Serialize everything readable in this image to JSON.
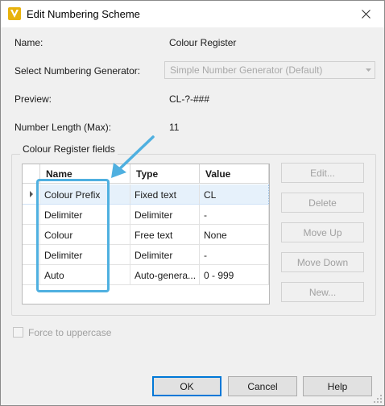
{
  "window": {
    "title": "Edit Numbering Scheme",
    "icon": "v-app-icon",
    "close_icon": "close-icon"
  },
  "form": {
    "name_label": "Name:",
    "name_value": "Colour Register",
    "generator_label": "Select Numbering Generator:",
    "generator_value": "Simple Number Generator (Default)",
    "preview_label": "Preview:",
    "preview_value": "CL-?-###",
    "length_label": "Number Length (Max):",
    "length_value": "11"
  },
  "fields_group": {
    "legend": "Colour Register fields",
    "columns": [
      "Name",
      "Type",
      "Value"
    ],
    "rows": [
      {
        "name": "Colour Prefix",
        "type": "Fixed text",
        "value": "CL",
        "selected": true
      },
      {
        "name": "Delimiter",
        "type": "Delimiter",
        "value": "-",
        "selected": false
      },
      {
        "name": "Colour",
        "type": "Free text",
        "value": "None",
        "selected": false
      },
      {
        "name": "Delimiter",
        "type": "Delimiter",
        "value": "-",
        "selected": false
      },
      {
        "name": "Auto",
        "type": "Auto-genera...",
        "value": "0 - 999",
        "selected": false
      }
    ],
    "buttons": {
      "edit": "Edit...",
      "delete": "Delete",
      "move_up": "Move Up",
      "move_down": "Move Down",
      "new": "New..."
    }
  },
  "options": {
    "uppercase_label": "Force to uppercase",
    "uppercase_checked": false
  },
  "footer": {
    "ok": "OK",
    "cancel": "Cancel",
    "help": "Help"
  },
  "colors": {
    "annotation": "#4fb0e0",
    "selection": "#e6f1fb",
    "app_icon": "#e8b20c"
  }
}
